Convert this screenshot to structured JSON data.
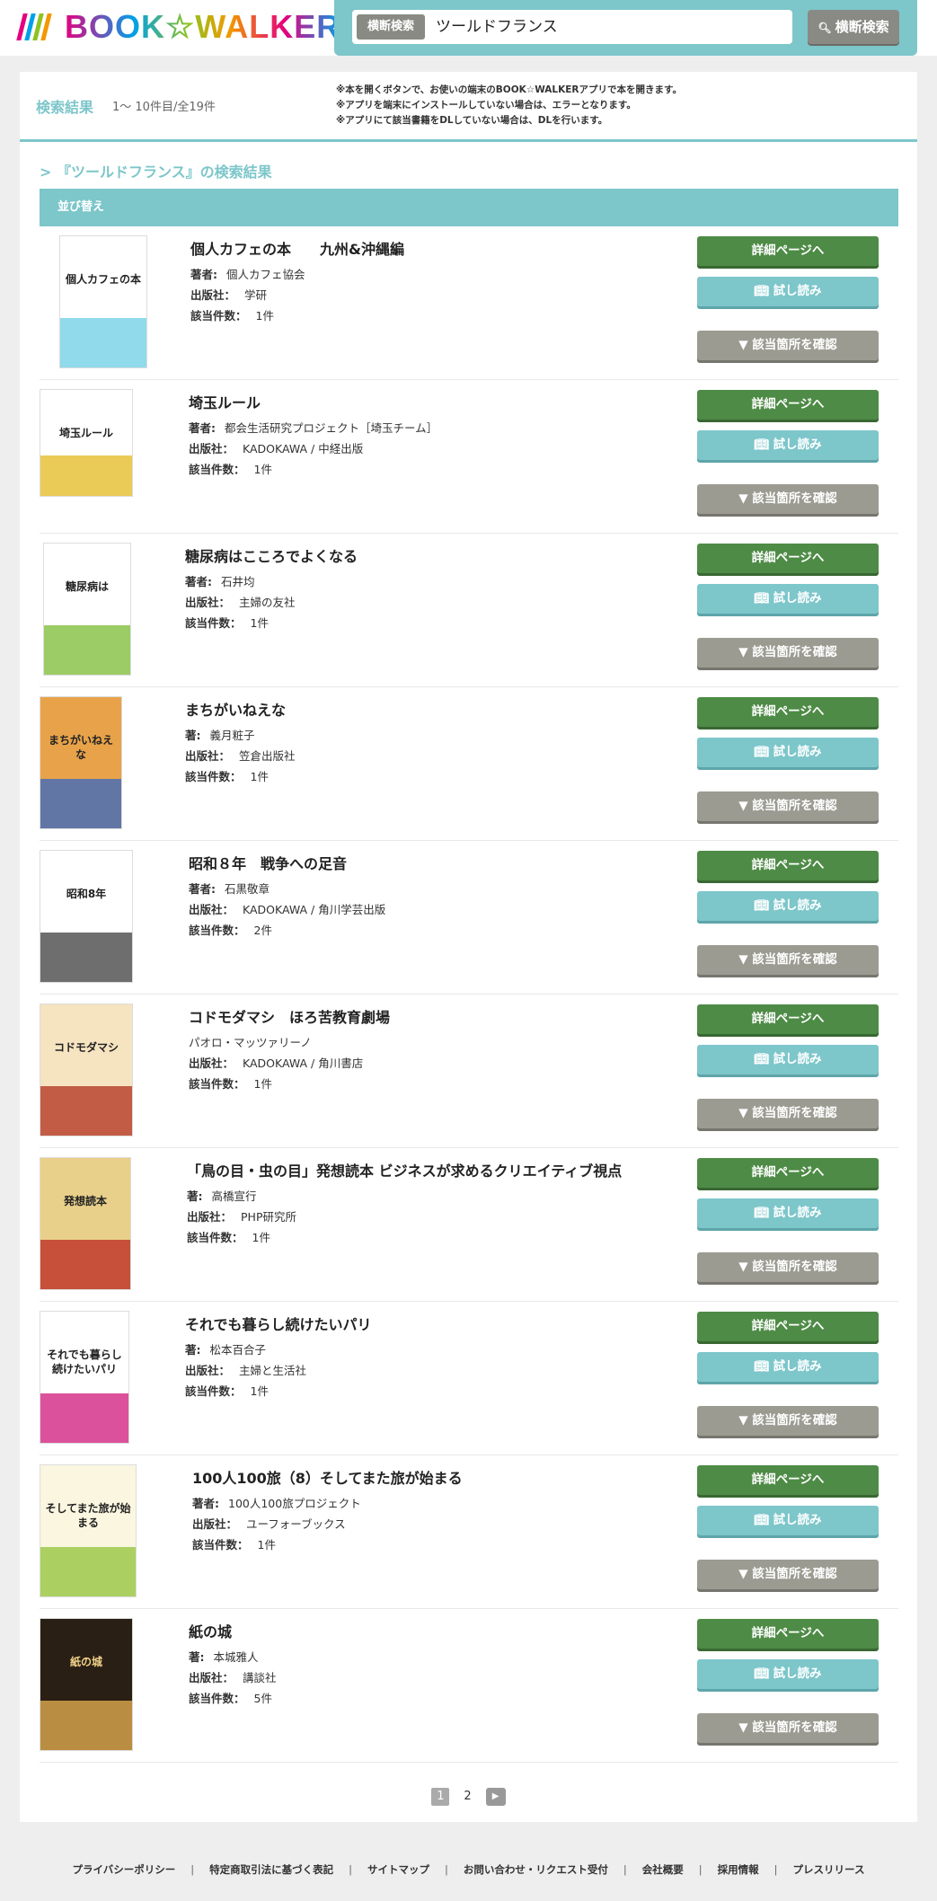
{
  "header": {
    "logo_text": "BOOK☆WALKER",
    "logo_colors": [
      "#e4007f",
      "#00a0e9",
      "#8fc31f",
      "#f39800"
    ],
    "search_tag": "横断検索",
    "search_query": "ツールドフランス",
    "search_button": "横断検索"
  },
  "results": {
    "label": "検索結果",
    "count": "1〜 10件目/全19件",
    "notes": [
      "※本を開くボタンで、お使いの端末のBOOK☆WALKERアプリで本を開きます。",
      "※アプリを端末にインストールしていない場合は、エラーとなります。",
      "※アプリにて該当書籍をDLしていない場合は、DLを行います。"
    ],
    "heading": "> 『ツールドフランス』の検索結果",
    "sort_label": "並び替え"
  },
  "buttons": {
    "detail": "詳細ページへ",
    "trial": "試し読み",
    "check": "▼ 該当箇所を確認"
  },
  "books": [
    {
      "title": "個人カフェの本　　九州&沖縄編",
      "author_key": "著者:",
      "author": "個人カフェ協会",
      "publisher_key": "出版社：",
      "publisher": "学研",
      "hits_key": "該当件数：",
      "hits": "1件",
      "cover_text": "個人カフェの本",
      "cover_bg": "#ffffff",
      "cover_accent": "#7dd3e8"
    },
    {
      "title": "埼玉ルール",
      "author_key": "著者:",
      "author": "都会生活研究プロジェクト［埼玉チーム］",
      "publisher_key": "出版社：",
      "publisher": "KADOKAWA / 中経出版",
      "hits_key": "該当件数：",
      "hits": "1件",
      "cover_text": "埼玉ルール",
      "cover_bg": "#ffffff",
      "cover_accent": "#e8c23a"
    },
    {
      "title": "糖尿病はこころでよくなる",
      "author_key": "著者:",
      "author": "石井均",
      "publisher_key": "出版社：",
      "publisher": "主婦の友社",
      "hits_key": "該当件数：",
      "hits": "1件",
      "cover_text": "糖尿病は",
      "cover_bg": "#ffffff",
      "cover_accent": "#8bc34a"
    },
    {
      "title": "まちがいねえな",
      "author_key": "著:",
      "author": "義月粧子",
      "publisher_key": "出版社：",
      "publisher": "笠倉出版社",
      "hits_key": "該当件数：",
      "hits": "1件",
      "cover_text": "まちがいねえな",
      "cover_bg": "#e8a34a",
      "cover_accent": "#4a6fb5"
    },
    {
      "title": "昭和８年　戦争への足音",
      "author_key": "著者:",
      "author": "石黒敬章",
      "publisher_key": "出版社：",
      "publisher": "KADOKAWA / 角川学芸出版",
      "hits_key": "該当件数：",
      "hits": "2件",
      "cover_text": "昭和8年",
      "cover_bg": "#ffffff",
      "cover_accent": "#555555"
    },
    {
      "title": "コドモダマシ　ほろ苦教育劇場",
      "author_key": "",
      "author": "パオロ・マッツァリーノ",
      "publisher_key": "出版社：",
      "publisher": "KADOKAWA / 角川書店",
      "hits_key": "該当件数：",
      "hits": "1件",
      "cover_text": "コドモダマシ",
      "cover_bg": "#f6e3c0",
      "cover_accent": "#b8442f"
    },
    {
      "title": "「鳥の目・虫の目」発想読本 ビジネスが求めるクリエイティブ視点",
      "author_key": "著:",
      "author": "高橋宣行",
      "publisher_key": "出版社：",
      "publisher": "PHP研究所",
      "hits_key": "該当件数：",
      "hits": "1件",
      "cover_text": "発想読本",
      "cover_bg": "#e9d08a",
      "cover_accent": "#c0392b"
    },
    {
      "title": "それでも暮らし続けたいパリ",
      "author_key": "著:",
      "author": "松本百合子",
      "publisher_key": "出版社：",
      "publisher": "主婦と生活社",
      "hits_key": "該当件数：",
      "hits": "1件",
      "cover_text": "それでも暮らし続けたいパリ",
      "cover_bg": "#ffffff",
      "cover_accent": "#d6338a"
    },
    {
      "title": "100人100旅（8）そしてまた旅が始まる",
      "author_key": "著者:",
      "author": "100人100旅プロジェクト",
      "publisher_key": "出版社：",
      "publisher": "ユーフォーブックス",
      "hits_key": "該当件数：",
      "hits": "1件",
      "cover_text": "そしてまた旅が始まる",
      "cover_bg": "#fbf6e0",
      "cover_accent": "#9cc94a"
    },
    {
      "title": "紙の城",
      "author_key": "著:",
      "author": "本城雅人",
      "publisher_key": "出版社：",
      "publisher": "講談社",
      "hits_key": "該当件数：",
      "hits": "5件",
      "cover_text": "紙の城",
      "cover_bg": "#2a1f14",
      "cover_accent": "#d4a24a"
    }
  ],
  "pager": {
    "current": "1",
    "next_page": "2"
  },
  "footer": {
    "links": [
      "プライバシーポリシー",
      "特定商取引法に基づく表記",
      "サイトマップ",
      "お問い合わせ・リクエスト受付",
      "会社概要",
      "採用情報",
      "プレスリリース"
    ]
  }
}
